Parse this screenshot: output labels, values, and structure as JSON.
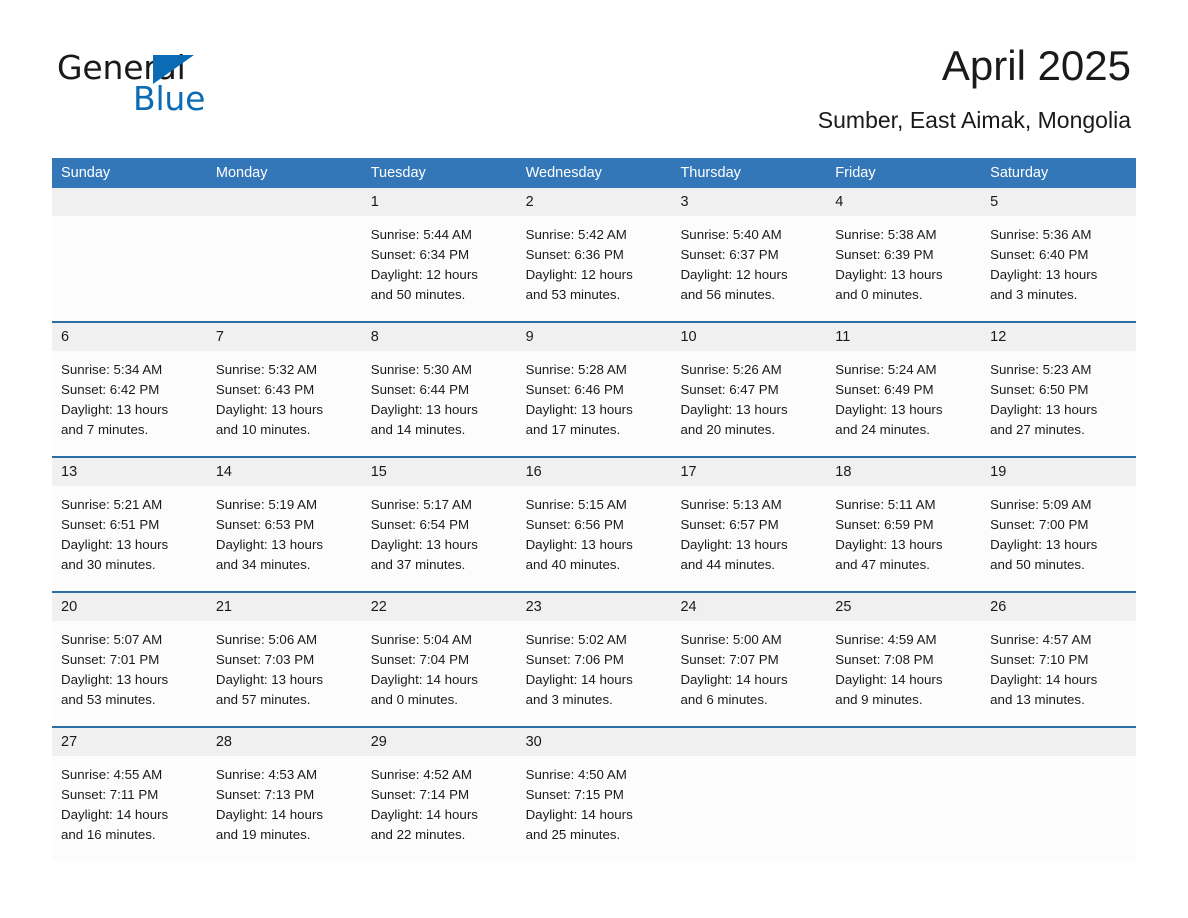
{
  "brand": {
    "name_part1": "General",
    "name_part2": "Blue",
    "accent_color": "#0b6cb5",
    "triangle_icon": "triangle-right-icon"
  },
  "header": {
    "month_title": "April 2025",
    "location": "Sumber, East Aimak, Mongolia"
  },
  "calendar": {
    "header_color": "#3477b8",
    "weekdays": [
      "Sunday",
      "Monday",
      "Tuesday",
      "Wednesday",
      "Thursday",
      "Friday",
      "Saturday"
    ],
    "weeks": [
      {
        "days": [
          {
            "num": "",
            "lines": []
          },
          {
            "num": "",
            "lines": []
          },
          {
            "num": "1",
            "lines": [
              "Sunrise: 5:44 AM",
              "Sunset: 6:34 PM",
              "Daylight: 12 hours",
              "and 50 minutes."
            ]
          },
          {
            "num": "2",
            "lines": [
              "Sunrise: 5:42 AM",
              "Sunset: 6:36 PM",
              "Daylight: 12 hours",
              "and 53 minutes."
            ]
          },
          {
            "num": "3",
            "lines": [
              "Sunrise: 5:40 AM",
              "Sunset: 6:37 PM",
              "Daylight: 12 hours",
              "and 56 minutes."
            ]
          },
          {
            "num": "4",
            "lines": [
              "Sunrise: 5:38 AM",
              "Sunset: 6:39 PM",
              "Daylight: 13 hours",
              "and 0 minutes."
            ]
          },
          {
            "num": "5",
            "lines": [
              "Sunrise: 5:36 AM",
              "Sunset: 6:40 PM",
              "Daylight: 13 hours",
              "and 3 minutes."
            ]
          }
        ]
      },
      {
        "days": [
          {
            "num": "6",
            "lines": [
              "Sunrise: 5:34 AM",
              "Sunset: 6:42 PM",
              "Daylight: 13 hours",
              "and 7 minutes."
            ]
          },
          {
            "num": "7",
            "lines": [
              "Sunrise: 5:32 AM",
              "Sunset: 6:43 PM",
              "Daylight: 13 hours",
              "and 10 minutes."
            ]
          },
          {
            "num": "8",
            "lines": [
              "Sunrise: 5:30 AM",
              "Sunset: 6:44 PM",
              "Daylight: 13 hours",
              "and 14 minutes."
            ]
          },
          {
            "num": "9",
            "lines": [
              "Sunrise: 5:28 AM",
              "Sunset: 6:46 PM",
              "Daylight: 13 hours",
              "and 17 minutes."
            ]
          },
          {
            "num": "10",
            "lines": [
              "Sunrise: 5:26 AM",
              "Sunset: 6:47 PM",
              "Daylight: 13 hours",
              "and 20 minutes."
            ]
          },
          {
            "num": "11",
            "lines": [
              "Sunrise: 5:24 AM",
              "Sunset: 6:49 PM",
              "Daylight: 13 hours",
              "and 24 minutes."
            ]
          },
          {
            "num": "12",
            "lines": [
              "Sunrise: 5:23 AM",
              "Sunset: 6:50 PM",
              "Daylight: 13 hours",
              "and 27 minutes."
            ]
          }
        ]
      },
      {
        "days": [
          {
            "num": "13",
            "lines": [
              "Sunrise: 5:21 AM",
              "Sunset: 6:51 PM",
              "Daylight: 13 hours",
              "and 30 minutes."
            ]
          },
          {
            "num": "14",
            "lines": [
              "Sunrise: 5:19 AM",
              "Sunset: 6:53 PM",
              "Daylight: 13 hours",
              "and 34 minutes."
            ]
          },
          {
            "num": "15",
            "lines": [
              "Sunrise: 5:17 AM",
              "Sunset: 6:54 PM",
              "Daylight: 13 hours",
              "and 37 minutes."
            ]
          },
          {
            "num": "16",
            "lines": [
              "Sunrise: 5:15 AM",
              "Sunset: 6:56 PM",
              "Daylight: 13 hours",
              "and 40 minutes."
            ]
          },
          {
            "num": "17",
            "lines": [
              "Sunrise: 5:13 AM",
              "Sunset: 6:57 PM",
              "Daylight: 13 hours",
              "and 44 minutes."
            ]
          },
          {
            "num": "18",
            "lines": [
              "Sunrise: 5:11 AM",
              "Sunset: 6:59 PM",
              "Daylight: 13 hours",
              "and 47 minutes."
            ]
          },
          {
            "num": "19",
            "lines": [
              "Sunrise: 5:09 AM",
              "Sunset: 7:00 PM",
              "Daylight: 13 hours",
              "and 50 minutes."
            ]
          }
        ]
      },
      {
        "days": [
          {
            "num": "20",
            "lines": [
              "Sunrise: 5:07 AM",
              "Sunset: 7:01 PM",
              "Daylight: 13 hours",
              "and 53 minutes."
            ]
          },
          {
            "num": "21",
            "lines": [
              "Sunrise: 5:06 AM",
              "Sunset: 7:03 PM",
              "Daylight: 13 hours",
              "and 57 minutes."
            ]
          },
          {
            "num": "22",
            "lines": [
              "Sunrise: 5:04 AM",
              "Sunset: 7:04 PM",
              "Daylight: 14 hours",
              "and 0 minutes."
            ]
          },
          {
            "num": "23",
            "lines": [
              "Sunrise: 5:02 AM",
              "Sunset: 7:06 PM",
              "Daylight: 14 hours",
              "and 3 minutes."
            ]
          },
          {
            "num": "24",
            "lines": [
              "Sunrise: 5:00 AM",
              "Sunset: 7:07 PM",
              "Daylight: 14 hours",
              "and 6 minutes."
            ]
          },
          {
            "num": "25",
            "lines": [
              "Sunrise: 4:59 AM",
              "Sunset: 7:08 PM",
              "Daylight: 14 hours",
              "and 9 minutes."
            ]
          },
          {
            "num": "26",
            "lines": [
              "Sunrise: 4:57 AM",
              "Sunset: 7:10 PM",
              "Daylight: 14 hours",
              "and 13 minutes."
            ]
          }
        ]
      },
      {
        "days": [
          {
            "num": "27",
            "lines": [
              "Sunrise: 4:55 AM",
              "Sunset: 7:11 PM",
              "Daylight: 14 hours",
              "and 16 minutes."
            ]
          },
          {
            "num": "28",
            "lines": [
              "Sunrise: 4:53 AM",
              "Sunset: 7:13 PM",
              "Daylight: 14 hours",
              "and 19 minutes."
            ]
          },
          {
            "num": "29",
            "lines": [
              "Sunrise: 4:52 AM",
              "Sunset: 7:14 PM",
              "Daylight: 14 hours",
              "and 22 minutes."
            ]
          },
          {
            "num": "30",
            "lines": [
              "Sunrise: 4:50 AM",
              "Sunset: 7:15 PM",
              "Daylight: 14 hours",
              "and 25 minutes."
            ]
          },
          {
            "num": "",
            "lines": []
          },
          {
            "num": "",
            "lines": []
          },
          {
            "num": "",
            "lines": []
          }
        ]
      }
    ]
  }
}
